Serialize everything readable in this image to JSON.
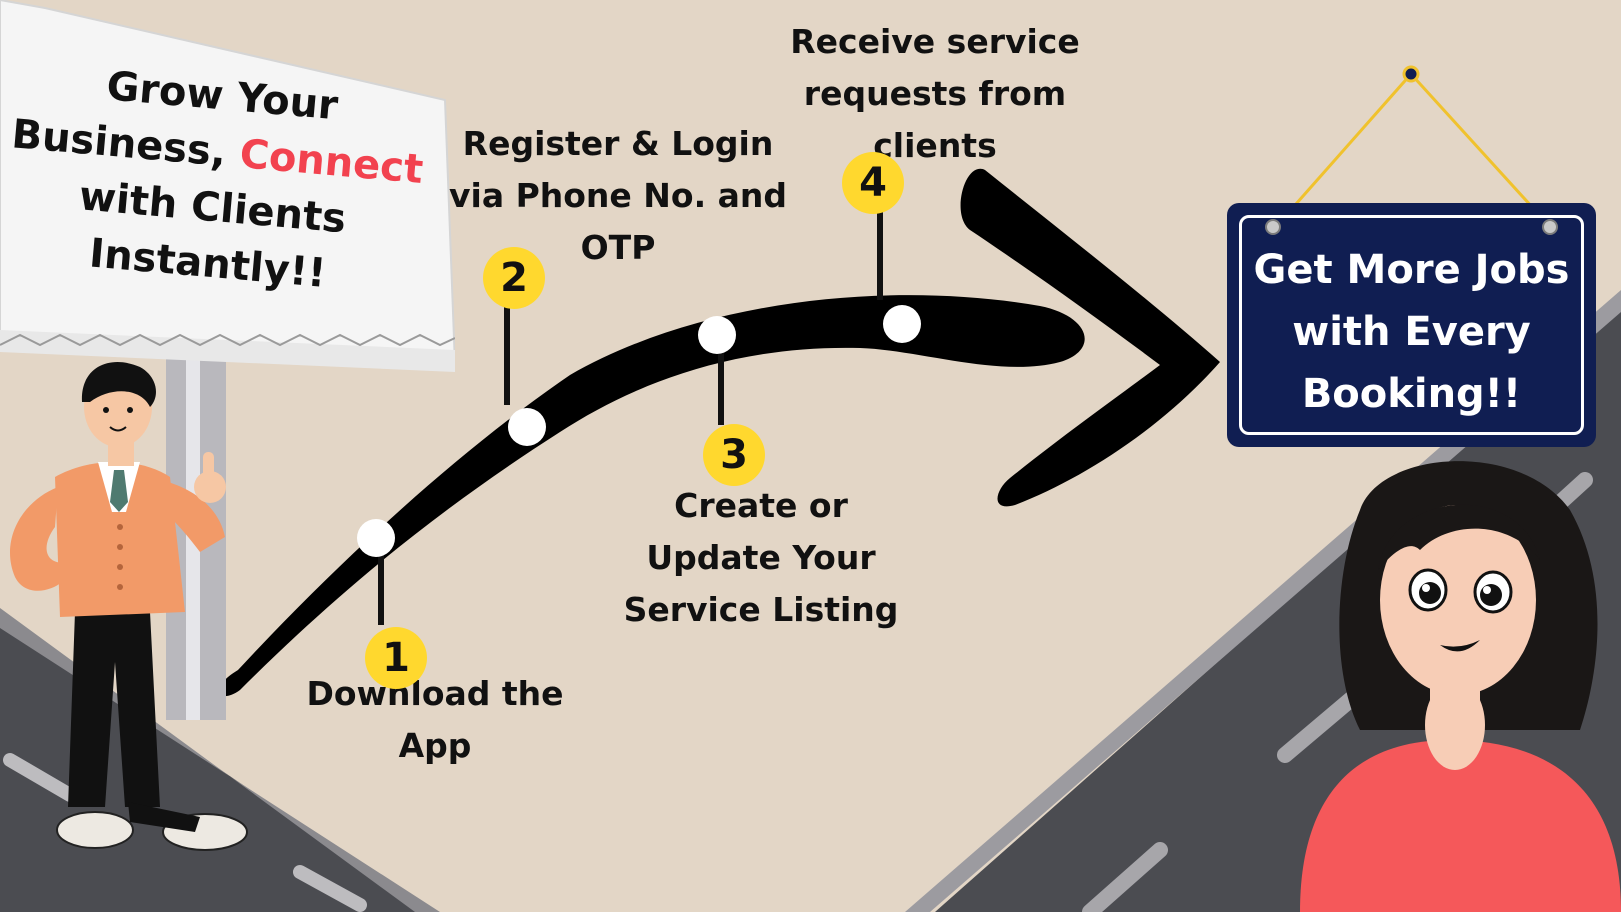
{
  "billboard": {
    "line1": "Grow Your",
    "line2_before": "Business, ",
    "line2_highlight": "Connect",
    "line3": "with Clients",
    "line4": "Instantly!!"
  },
  "steps": [
    {
      "number": "1",
      "label": "Download the App"
    },
    {
      "number": "2",
      "label": "Register & Login via Phone No. and OTP"
    },
    {
      "number": "3",
      "label": "Create or Update Your Service Listing"
    },
    {
      "number": "4",
      "label": "Receive service requests from clients"
    }
  ],
  "sign": {
    "line1": "Get More Jobs",
    "line2": "with Every",
    "line3": "Booking!!"
  },
  "colors": {
    "background": "#e3d6c6",
    "road": "#4b4c51",
    "path": "#000000",
    "badge": "#ffd82e",
    "highlight": "#f2424f",
    "sign_background": "#101e52",
    "sign_text": "#ffffff",
    "sign_string": "#f0c22d"
  }
}
